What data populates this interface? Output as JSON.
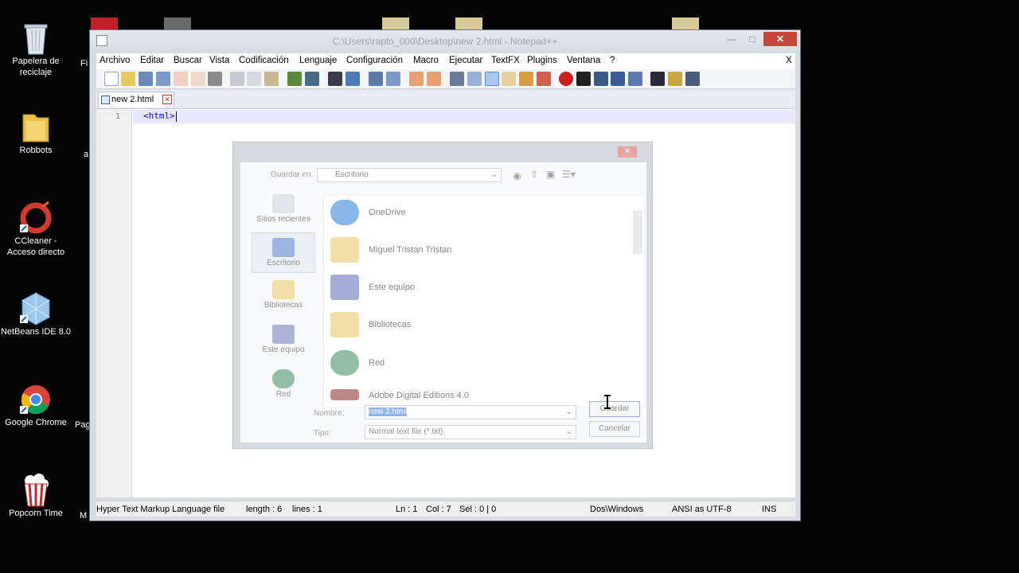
{
  "desktop": {
    "icons": [
      {
        "label": "Papelera de reciclaje",
        "icon": "recycle-bin-icon"
      },
      {
        "label": "Robbots",
        "icon": "folder-icon"
      },
      {
        "label": "CCleaner - Acceso directo",
        "icon": "ccleaner-icon"
      },
      {
        "label": "NetBeans IDE 8.0",
        "icon": "netbeans-icon"
      },
      {
        "label": "Google Chrome",
        "icon": "chrome-icon"
      },
      {
        "label": "Popcorn Time",
        "icon": "popcorn-icon"
      }
    ],
    "partial_labels": [
      "Fi",
      "a",
      "Pag",
      "M"
    ]
  },
  "window": {
    "title": "C:\\Users\\rapto_000\\Desktop\\new  2.html - Notepad++",
    "close_label": "✕",
    "minimize_label": "—",
    "maximize_label": "□"
  },
  "menu": {
    "items": [
      "Archivo",
      "Editar",
      "Buscar",
      "Vista",
      "Codificación",
      "Lenguaje",
      "Configuración",
      "Macro",
      "Ejecutar",
      "TextFX",
      "Plugins",
      "Ventana",
      "?"
    ],
    "close_doc": "X"
  },
  "tab": {
    "label": "new  2.html"
  },
  "editor": {
    "line_number": "1",
    "code": "<html>"
  },
  "status": {
    "filetype": "Hyper Text Markup Language file",
    "length": "length : 6",
    "lines": "lines : 1",
    "ln": "Ln : 1",
    "col": "Col : 7",
    "sel": "Sel : 0 | 0",
    "eol": "Dos\\Windows",
    "encoding": "ANSI as UTF-8",
    "mode": "INS"
  },
  "save_dialog": {
    "save_in_label": "Guardar en:",
    "save_in_value": "Escritorio",
    "places": [
      "Sitios recientes",
      "Escritorio",
      "Bibliotecas",
      "Este equipo",
      "Red"
    ],
    "files": [
      "OneDrive",
      "Miguel Tristan Tristan",
      "Este equipo",
      "Bibliotecas",
      "Red",
      "Adobe Digital Editions 4.0"
    ],
    "name_label": "Nombre:",
    "name_value": "new  2.html",
    "type_label": "Tipo:",
    "type_value": "Normal text file (*.txt)",
    "save_button": "Guardar",
    "cancel_button": "Cancelar"
  },
  "colors": {
    "accent_close": "#c7453a",
    "code_tag": "#0000ff",
    "current_line": "#e8e8ff"
  }
}
